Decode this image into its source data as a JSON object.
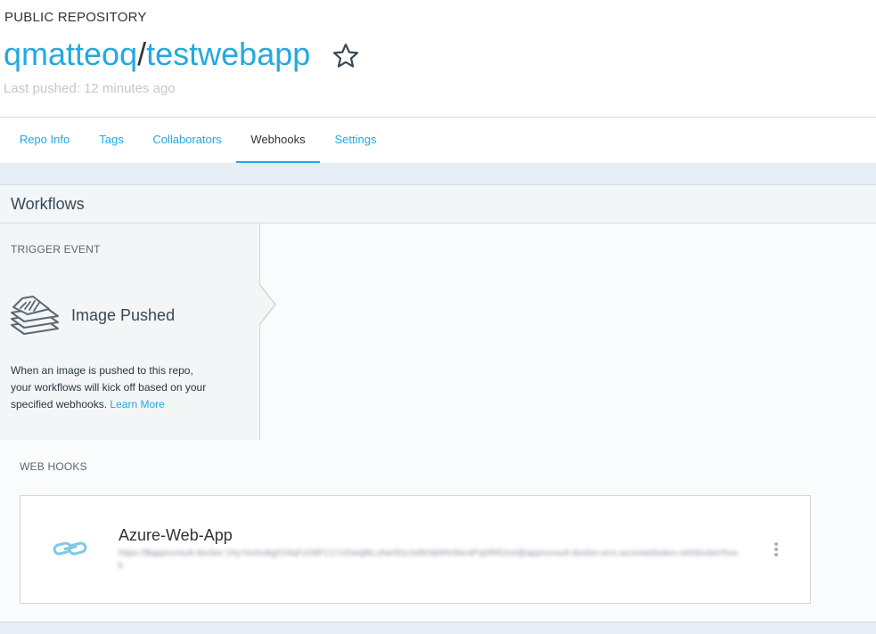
{
  "repo": {
    "visibility": "PUBLIC REPOSITORY",
    "owner": "qmatteoq",
    "separator": "/",
    "name": "testwebapp",
    "last_pushed": "Last pushed: 12 minutes ago"
  },
  "tabs": [
    {
      "label": "Repo Info",
      "active": false
    },
    {
      "label": "Tags",
      "active": false
    },
    {
      "label": "Collaborators",
      "active": false
    },
    {
      "label": "Webhooks",
      "active": true
    },
    {
      "label": "Settings",
      "active": false
    }
  ],
  "workflows": {
    "title": "Workflows",
    "trigger": {
      "label": "TRIGGER EVENT",
      "event_name": "Image Pushed",
      "description": "When an image is pushed to this repo, your workflows will kick off based on your specified webhooks.",
      "learn_more": "Learn More",
      "icon": "layers-icon"
    },
    "webhooks_label": "WEB HOOKS",
    "webhooks": [
      {
        "name": "Azure-Web-App",
        "url": "https://$appconsult-docker:1NyYocho8g01NqFzD8FC1YzDwq8tLuNerlDzJo8KNjWhr5ke4PqDRR2s4@appconsult-docker.scm.azurewebsites.net/docker/hook",
        "icon": "link-icon",
        "menu_icon": "kebab-menu-icon"
      }
    ]
  },
  "colors": {
    "accent": "#23a9e1",
    "band": "#e6edf4",
    "panel": "#f9fbfd"
  }
}
